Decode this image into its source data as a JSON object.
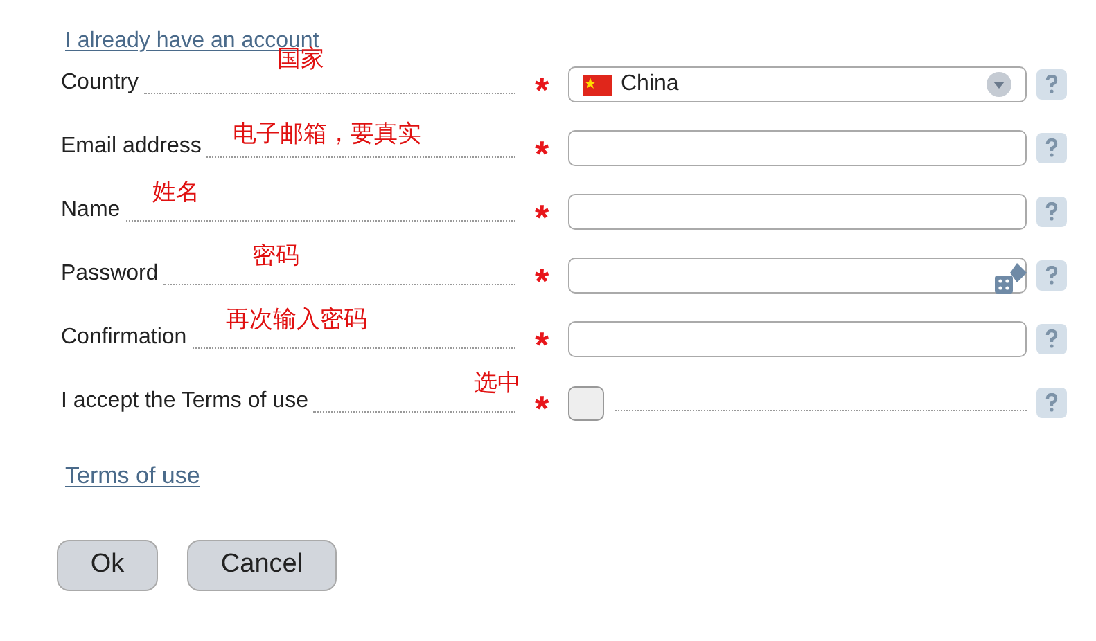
{
  "login_link": "I already have an account",
  "rows": [
    {
      "kind": "select",
      "label": "Country",
      "note": "国家",
      "marker": "*",
      "value": "China"
    },
    {
      "kind": "text",
      "label": "Email address",
      "note": "电子邮箱，要真实",
      "marker": "*"
    },
    {
      "kind": "text",
      "label": "Name",
      "note": "姓名",
      "marker": "*"
    },
    {
      "kind": "password",
      "label": "Password",
      "note": "密码",
      "marker": "*"
    },
    {
      "kind": "text",
      "label": "Confirmation",
      "note": "再次输入密码",
      "marker": "*"
    },
    {
      "kind": "checkbox",
      "label": "I accept the Terms of use",
      "note": "选中",
      "marker": "*",
      "checked": false
    }
  ],
  "terms_link": "Terms of use",
  "buttons": [
    "Ok",
    "Cancel"
  ]
}
